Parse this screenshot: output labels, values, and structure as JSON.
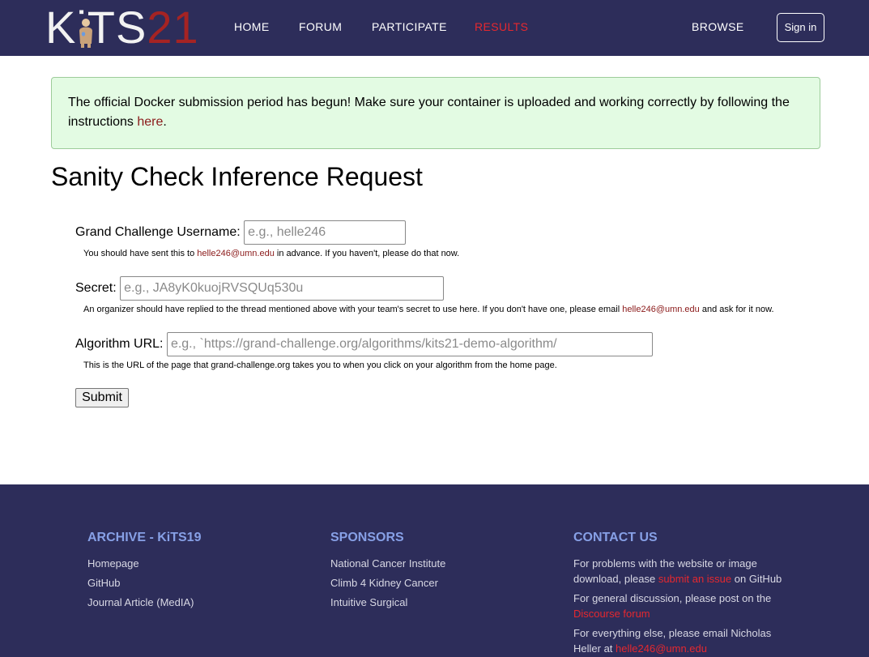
{
  "header": {
    "logo_text_white": "KiTS",
    "logo_text_red": "21",
    "nav": [
      {
        "label": "HOME"
      },
      {
        "label": "FORUM"
      },
      {
        "label": "PARTICIPATE"
      },
      {
        "label": "RESULTS",
        "active": true
      },
      {
        "label": "BROWSE"
      }
    ],
    "signin_label": "Sign in"
  },
  "alert": {
    "text": "The official Docker submission period has begun! Make sure your container is uploaded and working correctly by following the instructions ",
    "link_label": "here",
    "suffix": "."
  },
  "page_title": "Sanity Check Inference Request",
  "form": {
    "username": {
      "label": "Grand Challenge Username:",
      "placeholder": "e.g., helle246",
      "value": "",
      "help_prefix": "You should have sent this to ",
      "help_link": "helle246@umn.edu",
      "help_suffix": " in advance. If you haven't, please do that now."
    },
    "secret": {
      "label": "Secret:",
      "placeholder": "e.g., JA8yK0kuojRVSQUq530u",
      "value": "",
      "help_prefix": "An organizer should have replied to the thread mentioned above with your team's secret to use here. If you don't have one, please email ",
      "help_link": "helle246@umn.edu",
      "help_suffix": " and ask for it now."
    },
    "algorithm_url": {
      "label": "Algorithm URL:",
      "placeholder": "e.g., `https://grand-challenge.org/algorithms/kits21-demo-algorithm/",
      "value": "",
      "help": "This is the URL of the page that grand-challenge.org takes you to when you click on your algorithm from the home page."
    },
    "submit_label": "Submit"
  },
  "footer": {
    "archive": {
      "heading": "ARCHIVE - KiTS19",
      "links": [
        "Homepage",
        "GitHub",
        "Journal Article (MedIA)"
      ]
    },
    "sponsors": {
      "heading": "SPONSORS",
      "links": [
        "National Cancer Institute",
        "Climb 4 Kidney Cancer",
        "Intuitive Surgical"
      ]
    },
    "contact": {
      "heading": "CONTACT US",
      "p1_prefix": "For problems with the website or image download, please ",
      "p1_link": "submit an issue",
      "p1_suffix": " on GitHub",
      "p2_prefix": "For general discussion, please post on the ",
      "p2_link": "Discourse forum",
      "p3_prefix": "For everything else, please email Nicholas Heller at ",
      "p3_link": "helle246@umn.edu"
    }
  },
  "colors": {
    "navbar_bg": "#2d2d5a",
    "accent_red": "#e5282f",
    "link_dark_red": "#8b1a1a",
    "alert_bg": "#e3fbe3",
    "footer_heading": "#87a0e6"
  }
}
